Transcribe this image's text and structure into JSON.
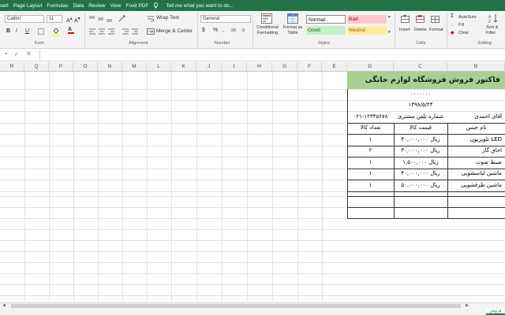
{
  "ribbon_tabs": [
    "sert",
    "Page Layout",
    "Formulas",
    "Data",
    "Review",
    "View",
    "Foxit PDF"
  ],
  "tell_me": "Tell me what you want to do...",
  "font": {
    "name": "Calibri",
    "size": "11"
  },
  "number_format": "General",
  "alignment": {
    "wrap_text": "Wrap Text",
    "merge_center": "Merge & Center"
  },
  "number_symbols": {
    "currency": "$",
    "percent": "%",
    "comma": "‚",
    "dec_inc": ".00",
    "dec_dec": ".0"
  },
  "format_buttons": {
    "B": "B",
    "I": "I",
    "U": "U"
  },
  "styles": {
    "cond_fmt": [
      "Conditional",
      "Formatting"
    ],
    "format_table": [
      "Format as",
      "Table"
    ],
    "items": [
      {
        "label": "Normal",
        "color": "#ffffff",
        "text": "#000000"
      },
      {
        "label": "Bad",
        "color": "#ffc7ce",
        "text": "#9c0006"
      },
      {
        "label": "Good",
        "color": "#c6efce",
        "text": "#006100"
      },
      {
        "label": "Neutral",
        "color": "#ffeb9c",
        "text": "#9c5700"
      }
    ]
  },
  "cells_group": {
    "insert": "Insert",
    "delete": "Delete",
    "format": "Format"
  },
  "editing": {
    "autosum": "AutoSum",
    "fill": "Fill",
    "clear": "Clear",
    "sort": [
      "Sort &",
      "Filter"
    ]
  },
  "group_labels": {
    "font": "Font",
    "alignment": "Alignment",
    "number": "Number",
    "styles": "Styles",
    "cells": "Cells",
    "editing": "Editing"
  },
  "formula_bar": {
    "cancel": "×",
    "enter": "✓",
    "fx": "fx"
  },
  "columns": [
    "R",
    "Q",
    "P",
    "O",
    "N",
    "M",
    "L",
    "K",
    "J",
    "I",
    "H",
    "G",
    "F",
    "E",
    "D",
    "C",
    "B"
  ],
  "invoice": {
    "title": "فاکتور فروش فروشگاه لوازم خانگی",
    "code": "۰۰۰۰۰۰۰",
    "date": "۱۳۹۸/۵/۲۴",
    "customer": "آقای احمدی",
    "phone_label": "شماره تلفن مشتری",
    "phone": "۰۲۱-۱۲۳۴۵۶۷۸",
    "headers": {
      "name": "نام جنس",
      "price": "قیمت کالا",
      "qty": "تعداد کالا"
    },
    "rows": [
      {
        "name": "تلویزیون LED",
        "price": "۳۰,۰۰۰,۰۰۰ ریال",
        "qty": "۱"
      },
      {
        "name": "اجاق گاز",
        "price": "۳۰,۰۰۰,۰۰۰ ریال",
        "qty": "۲"
      },
      {
        "name": "ضبط صوت",
        "price": "۱,۵۰۰,۰۰۰ ریال",
        "qty": "۱"
      },
      {
        "name": "ماشین لباسشویی",
        "price": "۴۰,۰۰۰,۰۰۰ ریال",
        "qty": "۱"
      },
      {
        "name": "ماشین ظرفشویی",
        "price": "۵۰,۰۰۰,۰۰۰ ریال",
        "qty": "۱"
      }
    ]
  },
  "sheet_tab": "فروش"
}
